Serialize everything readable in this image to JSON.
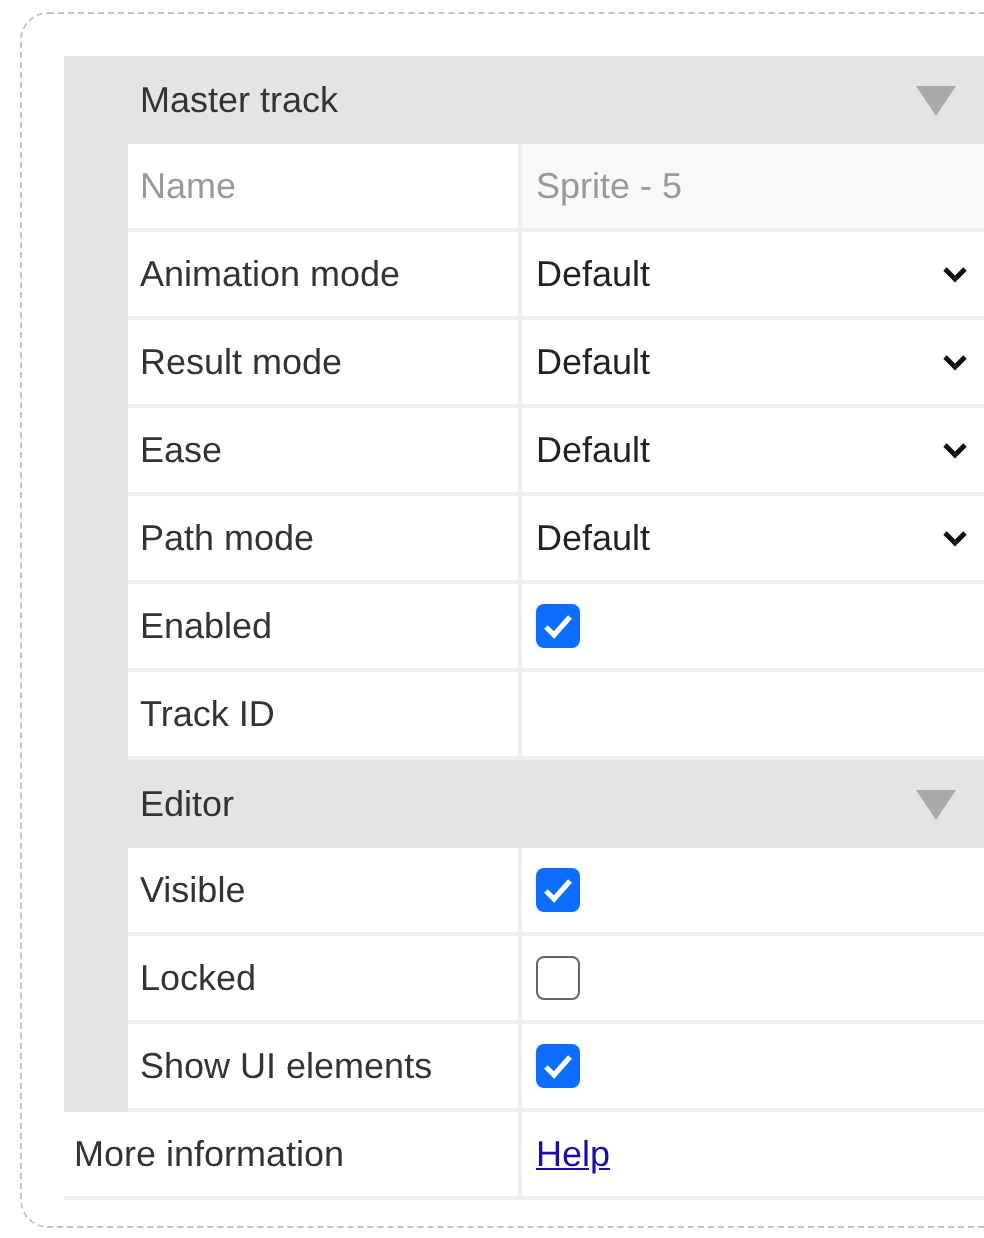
{
  "sections": [
    {
      "title": "Master track",
      "expanded": true,
      "rows": [
        {
          "kind": "text",
          "label": "Name",
          "value": "Sprite - 5",
          "disabled": true
        },
        {
          "kind": "select",
          "label": "Animation mode",
          "value": "Default",
          "disabled": false
        },
        {
          "kind": "select",
          "label": "Result mode",
          "value": "Default",
          "disabled": false
        },
        {
          "kind": "select",
          "label": "Ease",
          "value": "Default",
          "disabled": false
        },
        {
          "kind": "select",
          "label": "Path mode",
          "value": "Default",
          "disabled": false
        },
        {
          "kind": "checkbox",
          "label": "Enabled",
          "checked": true,
          "disabled": false
        },
        {
          "kind": "text",
          "label": "Track ID",
          "disabled": false
        }
      ]
    },
    {
      "title": "Editor",
      "expanded": true,
      "rows": [
        {
          "kind": "checkbox",
          "label": "Visible",
          "checked": true,
          "disabled": false
        },
        {
          "kind": "checkbox",
          "label": "Locked",
          "checked": false,
          "disabled": false
        },
        {
          "kind": "checkbox",
          "label": "Show UI elements",
          "checked": true,
          "disabled": false
        }
      ]
    }
  ],
  "footer": {
    "label": "More information",
    "link": "Help"
  }
}
